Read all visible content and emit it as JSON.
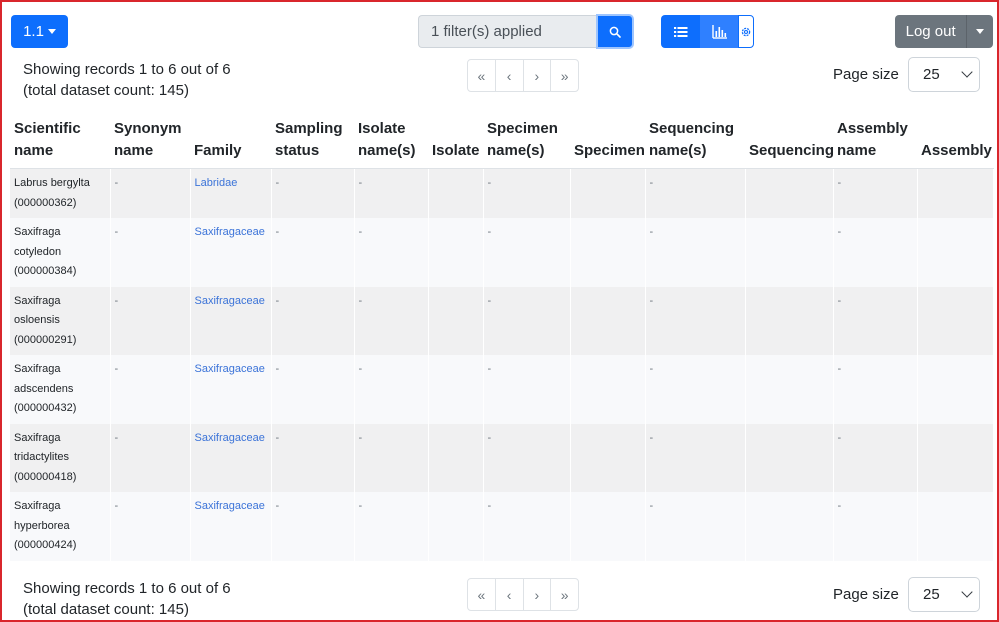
{
  "toolbar": {
    "version_label": "1.1",
    "filter_text": "1 filter(s) applied",
    "logout_label": "Log out"
  },
  "pagination": {
    "records_line1": "Showing records 1 to 6 out of 6",
    "records_line2": "(total dataset count: 145)",
    "first": "«",
    "prev": "‹",
    "next": "›",
    "last": "»",
    "page_size_label": "Page size",
    "page_size_value": "25"
  },
  "table": {
    "headers": [
      [
        "Scientific",
        "name"
      ],
      [
        "Synonym",
        "name"
      ],
      [
        "",
        "Family"
      ],
      [
        "Sampling",
        "status"
      ],
      [
        "Isolate",
        "name(s)"
      ],
      [
        "",
        "Isolate"
      ],
      [
        "Specimen",
        "name(s)"
      ],
      [
        "",
        "Specimen"
      ],
      [
        "Sequencing",
        "name(s)"
      ],
      [
        "",
        "Sequencing"
      ],
      [
        "Assembly",
        "name"
      ],
      [
        "",
        "Assembly"
      ]
    ],
    "rows": [
      {
        "name": [
          "Labrus bergylta",
          "(000000362)"
        ],
        "family": "Labridae"
      },
      {
        "name": [
          "Saxifraga",
          "cotyledon",
          "(000000384)"
        ],
        "family": "Saxifragaceae"
      },
      {
        "name": [
          "Saxifraga",
          "osloensis",
          "(000000291)"
        ],
        "family": "Saxifragaceae"
      },
      {
        "name": [
          "Saxifraga",
          "adscendens",
          "(000000432)"
        ],
        "family": "Saxifragaceae"
      },
      {
        "name": [
          "Saxifraga",
          "tridactylites",
          "(000000418)"
        ],
        "family": "Saxifragaceae"
      },
      {
        "name": [
          "Saxifraga",
          "hyperborea",
          "(000000424)"
        ],
        "family": "Saxifragaceae"
      }
    ],
    "empty_value": "-"
  },
  "colors": {
    "primary": "#0d6efd",
    "secondary": "#6c757d",
    "link": "#3b73d8",
    "frame": "#d9262c"
  },
  "icons": {
    "search": "search-icon",
    "list": "list-icon",
    "chart": "bar-chart-icon",
    "settings": "gear-icon"
  }
}
